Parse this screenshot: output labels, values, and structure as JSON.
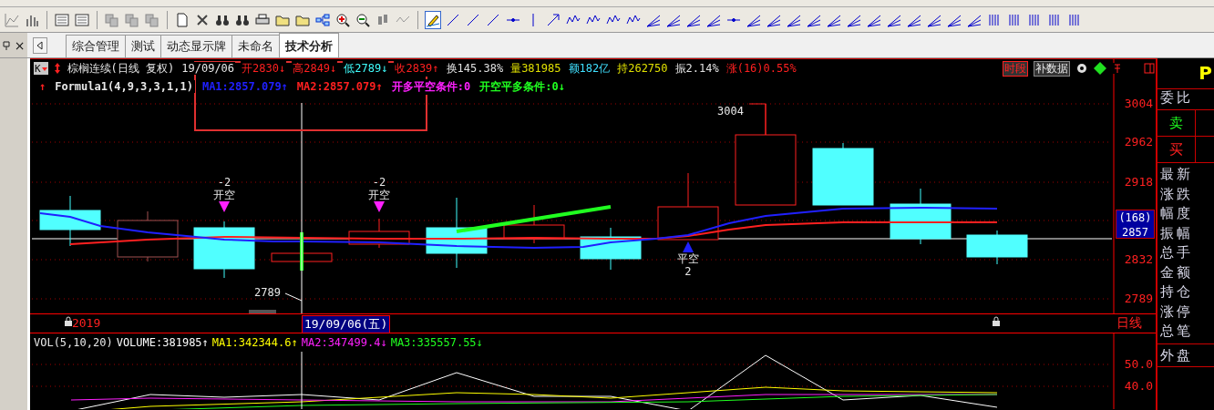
{
  "tab_bar": {
    "close_glyph": "×",
    "tabs": [
      {
        "label": "综合管理",
        "selected": false
      },
      {
        "label": "测试",
        "selected": false
      },
      {
        "label": "动态显示牌",
        "selected": false
      },
      {
        "label": "未命名",
        "selected": false
      },
      {
        "label": "技术分析",
        "selected": true
      }
    ]
  },
  "quote_header": {
    "period_button": "K",
    "title": "棕榈连续(日线 复权)",
    "date": "19/09/06",
    "fields": [
      {
        "text": "开2830↓",
        "color": "#ff2020"
      },
      {
        "text": "高2849↓",
        "color": "#ff2020"
      },
      {
        "text": "低2789↓",
        "color": "#40ffff"
      },
      {
        "text": "收2839↑",
        "color": "#ff2020"
      },
      {
        "text": "换145.38%",
        "color": "#e0e0e0"
      },
      {
        "text": "量381985",
        "color": "#e0e000"
      },
      {
        "text": "额182亿",
        "color": "#40e0ff"
      },
      {
        "text": "持262750",
        "color": "#e0e000"
      },
      {
        "text": "振2.14%",
        "color": "#e0e0e0"
      },
      {
        "text": "涨(16)0.55%",
        "color": "#ff2020"
      }
    ],
    "buttons": [
      "时段",
      "补数据"
    ]
  },
  "indicator_line": {
    "arrow": "↑",
    "name": "Formula1(4,9,3,3,1,1)",
    "values": [
      {
        "text": "MA1:2857.079↑",
        "color": "#2020ff"
      },
      {
        "text": "MA2:2857.079↑",
        "color": "#ff2020"
      },
      {
        "text": "开多平空条件:0",
        "color": "#ff20ff"
      },
      {
        "text": "开空平多条件:0↓",
        "color": "#20ff20"
      }
    ]
  },
  "price_axis": {
    "ticks": [
      "3004",
      "2962",
      "2918",
      "2832",
      "2789"
    ],
    "current_tag": {
      "change": "(168)",
      "price": "2857"
    }
  },
  "chart_labels": {
    "high": "3004",
    "low": "2789",
    "signals": [
      {
        "kind": "sell",
        "value": "-2",
        "label": "开空"
      },
      {
        "kind": "sell",
        "value": "-2",
        "label": "开空"
      },
      {
        "kind": "buy",
        "label": "平空",
        "value": "2"
      }
    ]
  },
  "date_bar": {
    "year": "2019",
    "cursor_date": "19/09/06(五)",
    "period": "日线"
  },
  "volume_header": {
    "name": "VOL(5,10,20)",
    "values": [
      {
        "text": "VOLUME:381985↑",
        "color": "#ffffff"
      },
      {
        "text": "MA1:342344.6↑",
        "color": "#ffff00"
      },
      {
        "text": "MA2:347499.4↓",
        "color": "#ff20ff"
      },
      {
        "text": "MA3:335557.55↓",
        "color": "#20ff20"
      }
    ]
  },
  "volume_axis": {
    "ticks": [
      "50.0",
      "40.0"
    ]
  },
  "side_panel": {
    "code": "P",
    "ratio_label": "委比",
    "sell_label": "卖",
    "buy_label": "买",
    "fields": [
      "最新",
      "涨跌",
      "幅度",
      "振幅",
      "总手",
      "金额",
      "持仓",
      "涨停",
      "总笔"
    ],
    "outer_label": "外盘"
  }
}
